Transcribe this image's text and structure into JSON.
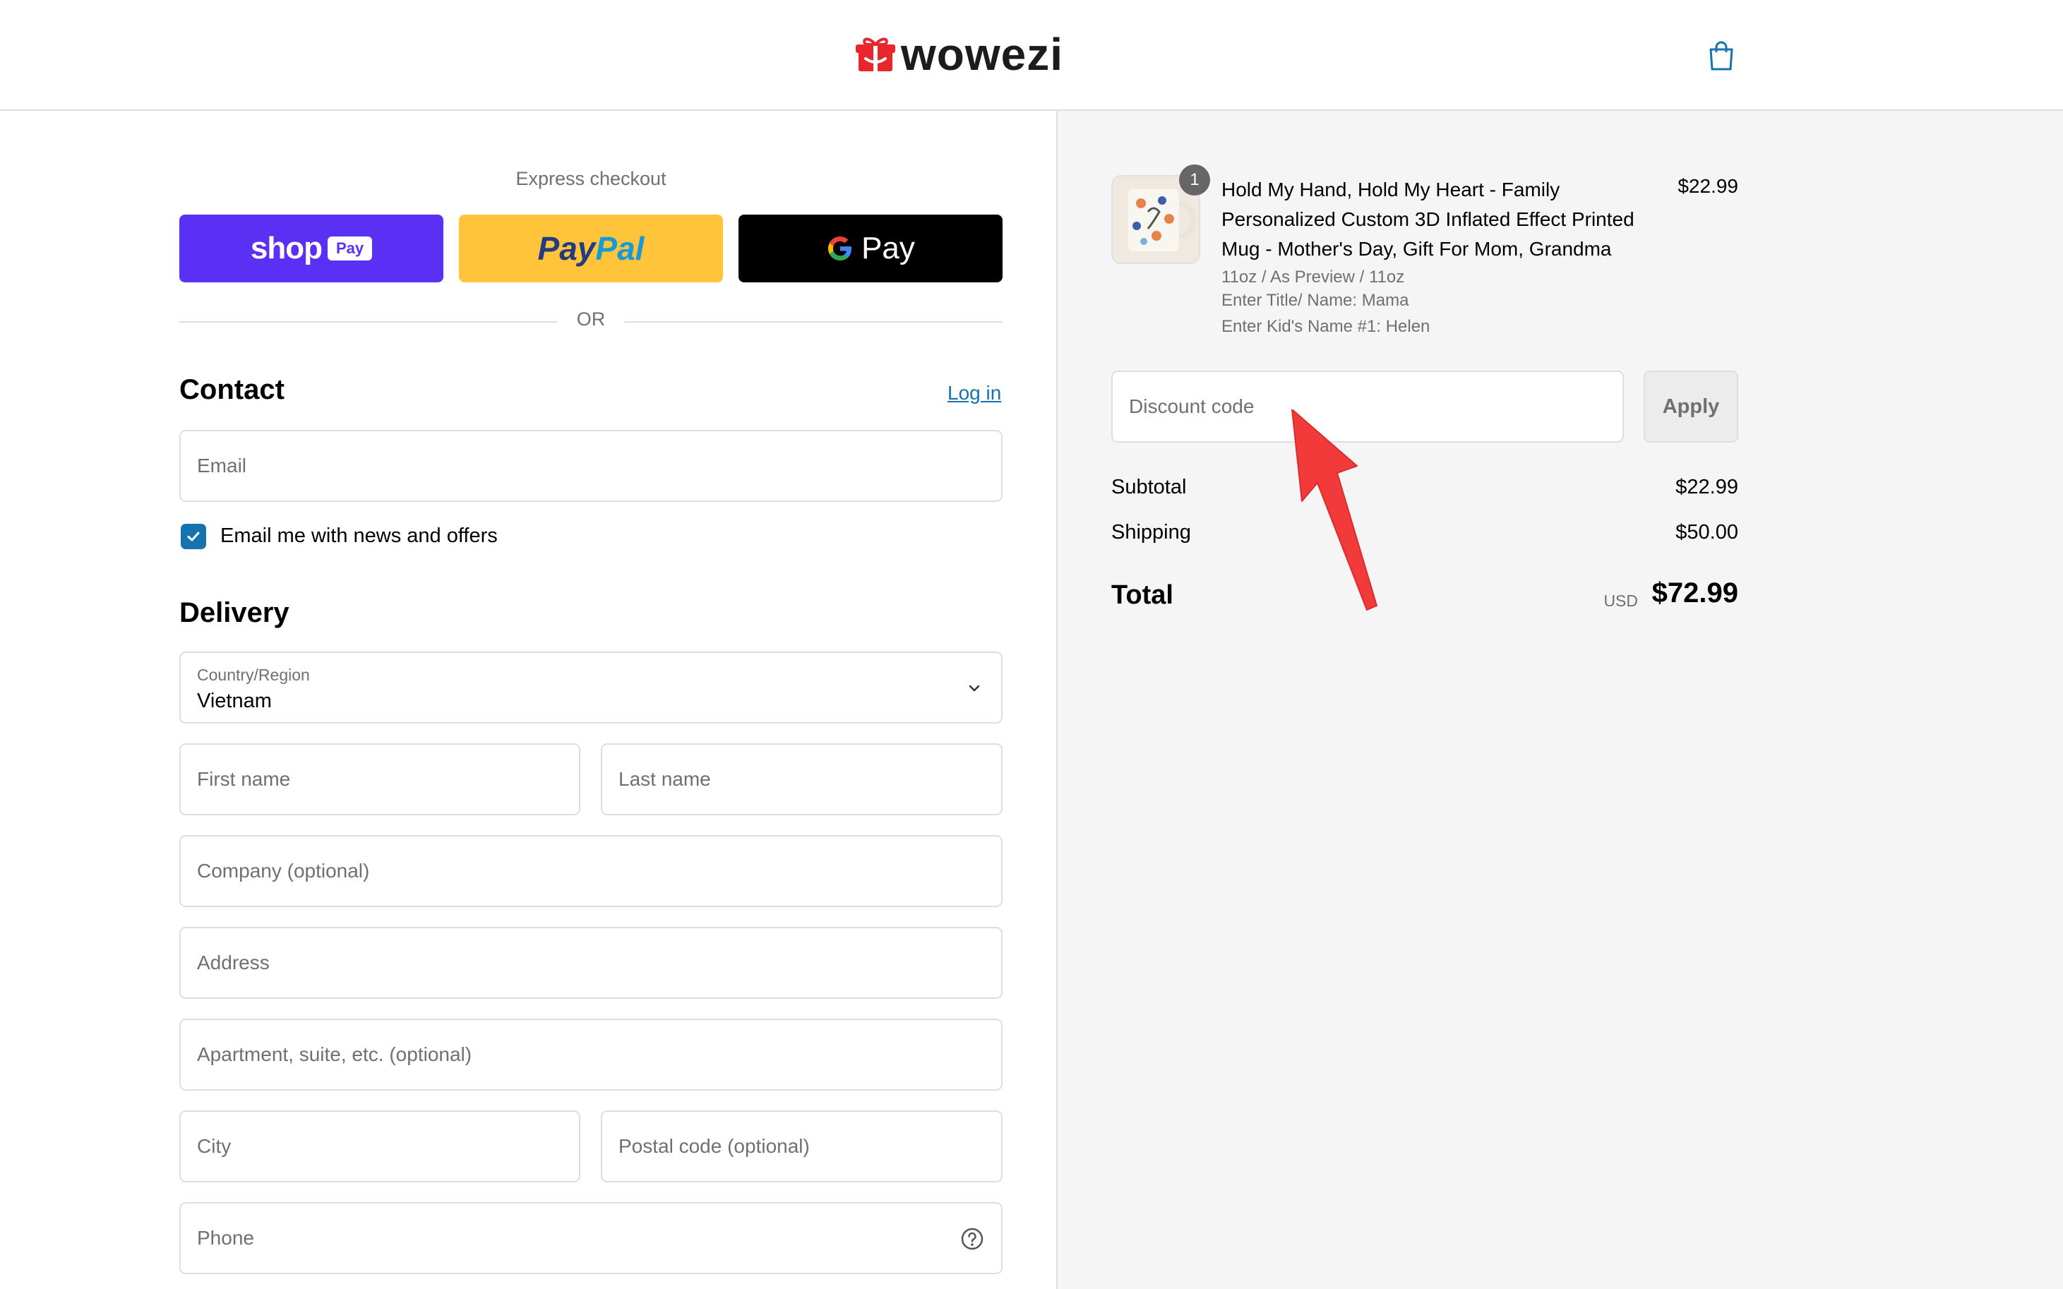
{
  "header": {
    "brand": "wowezi",
    "cart_icon": "shopping-bag-icon"
  },
  "express": {
    "title": "Express checkout",
    "shop_word": "shop",
    "shop_pill": "Pay",
    "paypal_1": "Pay",
    "paypal_2": "Pal",
    "gpay_g": "G",
    "gpay_text": "Pay",
    "or": "OR"
  },
  "contact": {
    "title": "Contact",
    "login": "Log in",
    "email_placeholder": "Email",
    "news_label": "Email me with news and offers",
    "news_checked": true
  },
  "delivery": {
    "title": "Delivery",
    "country_label": "Country/Region",
    "country_value": "Vietnam",
    "first_name": "First name",
    "last_name": "Last name",
    "company": "Company (optional)",
    "address": "Address",
    "apartment": "Apartment, suite, etc. (optional)",
    "city": "City",
    "postal": "Postal code (optional)",
    "phone": "Phone"
  },
  "order": {
    "item": {
      "quantity": "1",
      "title": "Hold My Hand, Hold My Heart - Family Personalized Custom 3D Inflated Effect Printed Mug - Mother's Day, Gift For Mom, Grandma",
      "price": "$22.99",
      "variant": "11oz / As Preview / 11oz",
      "meta_title": "Enter Title/ Name: Mama",
      "meta_kid": "Enter Kid's Name #1: Helen"
    },
    "discount_placeholder": "Discount code",
    "apply": "Apply",
    "subtotal_label": "Subtotal",
    "subtotal_value": "$22.99",
    "shipping_label": "Shipping",
    "shipping_value": "$50.00",
    "total_label": "Total",
    "currency": "USD",
    "total_value": "$72.99"
  },
  "colors": {
    "shop_pay": "#5a31f4",
    "paypal": "#ffc439",
    "gpay": "#000000",
    "accent": "#1773b0",
    "annotation_arrow": "#f23a3a",
    "brand_red": "#e8262b"
  }
}
